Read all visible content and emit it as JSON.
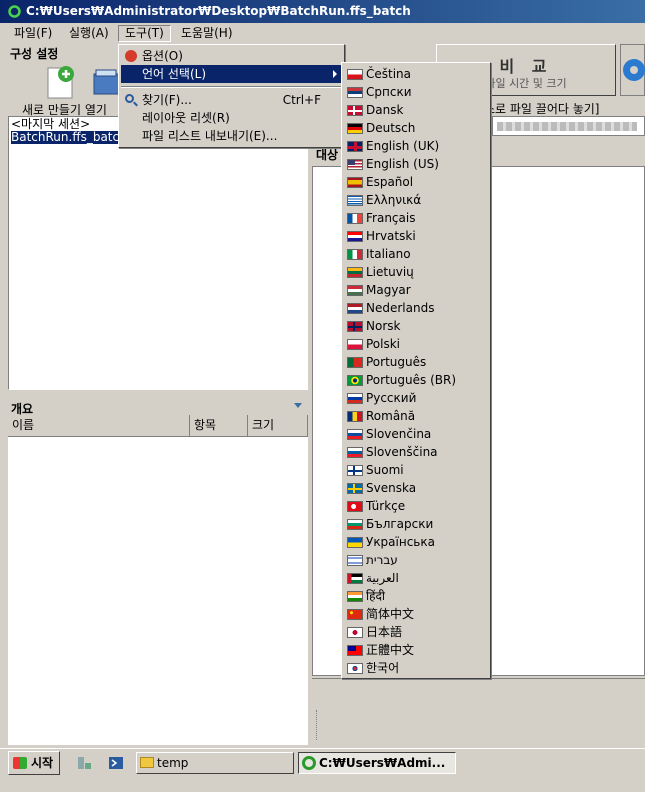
{
  "window": {
    "title": "C:₩Users₩Administrator₩Desktop₩BatchRun.ffs_batch"
  },
  "menubar": {
    "items": [
      "파일(F)",
      "실행(A)",
      "도구(T)",
      "도움말(H)"
    ]
  },
  "config_panel": {
    "title": "구성 설정",
    "toolbar_labels": "새로 만들기  열기",
    "items": [
      "<마지막 세션>",
      "BatchRun.ffs_batch"
    ]
  },
  "overview": {
    "title": "개요",
    "columns": [
      "이름",
      "항목",
      "크기"
    ]
  },
  "compare": {
    "label": "비 교",
    "sub_label": "파일 시간 및 크기"
  },
  "drop_hint": "스로 파일 끌어다 놓기]",
  "target_label": "대상",
  "tools_menu": {
    "options": "옵션(O)",
    "select_language": "언어 선택(L)",
    "find": "찾기(F)...",
    "find_shortcut": "Ctrl+F",
    "reset_layout": "레이아웃 리셋(R)",
    "export_list": "파일 리스트 내보내기(E)..."
  },
  "languages": [
    {
      "name": "Čeština",
      "flag": "cz"
    },
    {
      "name": "Српски",
      "flag": "rs"
    },
    {
      "name": "Dansk",
      "flag": "dk"
    },
    {
      "name": "Deutsch",
      "flag": "de"
    },
    {
      "name": "English (UK)",
      "flag": "gb"
    },
    {
      "name": "English (US)",
      "flag": "us"
    },
    {
      "name": "Español",
      "flag": "es"
    },
    {
      "name": "Ελληνικά",
      "flag": "gr"
    },
    {
      "name": "Français",
      "flag": "fr"
    },
    {
      "name": "Hrvatski",
      "flag": "hr"
    },
    {
      "name": "Italiano",
      "flag": "it"
    },
    {
      "name": "Lietuvių",
      "flag": "lt"
    },
    {
      "name": "Magyar",
      "flag": "hu"
    },
    {
      "name": "Nederlands",
      "flag": "nl"
    },
    {
      "name": "Norsk",
      "flag": "no"
    },
    {
      "name": "Polski",
      "flag": "pl"
    },
    {
      "name": "Português",
      "flag": "pt"
    },
    {
      "name": "Português (BR)",
      "flag": "br"
    },
    {
      "name": "Русский",
      "flag": "ru"
    },
    {
      "name": "Română",
      "flag": "ro"
    },
    {
      "name": "Slovenčina",
      "flag": "sk"
    },
    {
      "name": "Slovenščina",
      "flag": "si"
    },
    {
      "name": "Suomi",
      "flag": "fi"
    },
    {
      "name": "Svenska",
      "flag": "se"
    },
    {
      "name": "Türkçe",
      "flag": "tr"
    },
    {
      "name": "Български",
      "flag": "bg"
    },
    {
      "name": "Українська",
      "flag": "ua"
    },
    {
      "name": "עברית",
      "flag": "il"
    },
    {
      "name": "العربية",
      "flag": "ar"
    },
    {
      "name": "हिंदी",
      "flag": "in"
    },
    {
      "name": "简体中文",
      "flag": "cn"
    },
    {
      "name": "日本語",
      "flag": "jp"
    },
    {
      "name": "正體中文",
      "flag": "tw"
    },
    {
      "name": "한국어",
      "flag": "kr"
    }
  ],
  "taskbar": {
    "start": "시작",
    "tasks": [
      "temp",
      "C:₩Users₩Admi..."
    ]
  }
}
